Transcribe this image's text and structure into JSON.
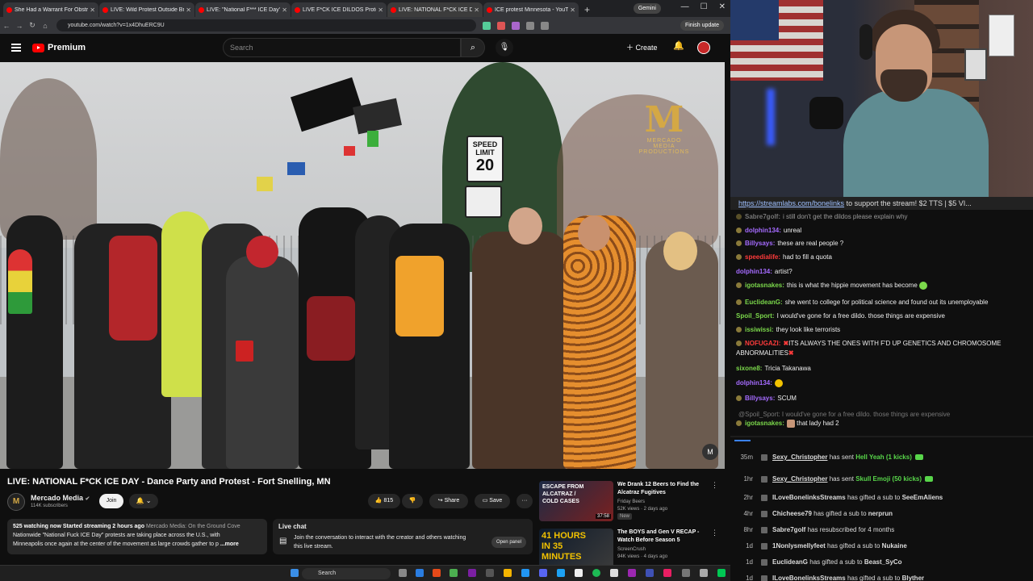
{
  "browser": {
    "tabs": [
      {
        "title": "She Had a Warrant For Obstru"
      },
      {
        "title": "LIVE: Wild Protest Outside Bro"
      },
      {
        "title": "LIVE: \"National F*** ICE Day\" Pa"
      },
      {
        "title": "LIVE F*CK ICE DILDOS Protest I"
      },
      {
        "title": "LIVE: NATIONAL F*CK ICE D"
      },
      {
        "title": "ICE protest Minnesota - YouTu"
      }
    ],
    "new_tab": "+",
    "gemini": "Gemini",
    "url": "youtube.com/watch?v=1x4DhuERC9U",
    "finish_update": "Finish update"
  },
  "youtube": {
    "logo": "Premium",
    "search_placeholder": "Search",
    "create": "Create"
  },
  "video": {
    "sign_top": "SPEED LIMIT",
    "sign_num": "20",
    "watermark_big": "M",
    "watermark_small": "MERCADO MEDIA PRODUCTIONS",
    "corner_logo": "M",
    "title": "LIVE: NATIONAL F*CK ICE DAY - Dance Party and Protest - Fort Snelling, MN"
  },
  "channel": {
    "name": "Mercado Media",
    "subs": "114K subscribers",
    "join": "Join",
    "likes": "815",
    "share": "Share",
    "save": "Save",
    "more": "···"
  },
  "description": {
    "stats": "525 watching now  Started streaming 2 hours ago",
    "snippet": "Mercado Media: On the Ground Cove",
    "line2": "Nationwide \"National Fuck ICE Day\" protests are taking place across the U.S., with",
    "line3": "Minneapolis once again at the center of the movement as large crowds gather to p",
    "more": "...more"
  },
  "livechat": {
    "title": "Live chat",
    "body": "Join the conversation to interact with the creator and others watching this live stream.",
    "open": "Open panel"
  },
  "recs": [
    {
      "title": "We Drank 12 Beers to Find the Alcatraz Fugitives",
      "channel": "Friday Beers",
      "meta": "52K views · 2 days ago",
      "badge": "New",
      "duration": "37:58",
      "thumb_text": "ESCAPE FROM ALCATRAZ / COLD CASES"
    },
    {
      "title": "The BOYS and Gen V RECAP - Watch Before Season 5",
      "channel": "ScreenCrush",
      "meta": "94K views · 4 days ago",
      "thumb_text": "41 HOURS IN 35 MINUTES"
    }
  ],
  "taskbar": {
    "search": "Search"
  },
  "stream": {
    "ticker_link": "https://streamlabs.com/bonelinks",
    "ticker_rest": " to support the stream! $2 TTS | $5 VI..."
  },
  "chat": [
    {
      "user": "Sabre7golf:",
      "text": "i still don't get the dildos please explain why",
      "color": "#bbbbbb"
    },
    {
      "user": "dolphin134:",
      "text": "unreal",
      "color": "#a56bff"
    },
    {
      "user": "Billysays:",
      "text": "these are real people ?",
      "color": "#a56bff"
    },
    {
      "user": "speedialife:",
      "text": "had to fill a quota",
      "color": "#ff3b3b"
    },
    {
      "user": "dolphin134:",
      "text": "artist?",
      "color": "#a56bff"
    },
    {
      "user": "igotasnakes:",
      "text": "this is what the hippie movement has become",
      "color": "#7bd84b"
    },
    {
      "user": "EuclideanG:",
      "text": "she went to college for political science and found out its unemployable",
      "color": "#7bd84b"
    },
    {
      "user": "Spoil_Sport:",
      "text": "I would've gone for a free dildo. those things are expensive",
      "color": "#7bd84b"
    },
    {
      "user": "issiwissi:",
      "text": "they look like terrorists",
      "color": "#7bd84b"
    },
    {
      "user": "NOFUGAZI:",
      "text": "ITS ALWAYS THE ONES WITH F'D UP GENETICS AND CHROMOSOME ABNORMALITIES",
      "color": "#ff3b3b"
    },
    {
      "user": "sixone8:",
      "text": "Tricia Takanawa",
      "color": "#7bd84b"
    },
    {
      "user": "dolphin134:",
      "text": "",
      "color": "#a56bff"
    },
    {
      "user": "Billysays:",
      "text": "SCUM",
      "color": "#a56bff"
    },
    {
      "user": "igotasnakes:",
      "text": "that lady had 2",
      "color": "#7bd84b"
    }
  ],
  "chat_reply": "@Spoil_Sport: I would've gone for a free dildo. those things are expensive",
  "events": [
    {
      "time": "35m",
      "user": "Sexy_Christopher",
      "action": "has sent",
      "item": "Hell Yeah (1 kicks)",
      "kicks": true
    },
    {
      "time": "1hr",
      "user": "Sexy_Christopher",
      "action": "has sent",
      "item": "Skull Emoji (50 kicks)",
      "kicks": true
    },
    {
      "time": "2hr",
      "user": "ILoveBonelinksStreams",
      "action": "has gifted a sub to",
      "item": "SeeEmAliens",
      "kicks": false
    },
    {
      "time": "4hr",
      "user": "Chicheese79",
      "action": "has gifted a sub to",
      "item": "nerprun",
      "kicks": false
    },
    {
      "time": "8hr",
      "user": "Sabre7golf",
      "action": "has resubscribed for 4 months",
      "item": "",
      "kicks": false
    },
    {
      "time": "1d",
      "user": "1Nonlysmellyfeet",
      "action": "has gifted a sub to",
      "item": "Nukaine",
      "kicks": false
    },
    {
      "time": "1d",
      "user": "EuclideanG",
      "action": "has gifted a sub to",
      "item": "Beast_SyCo",
      "kicks": false
    },
    {
      "time": "1d",
      "user": "ILoveBonelinksStreams",
      "action": "has gifted a sub to",
      "item": "Blyther",
      "kicks": false
    }
  ]
}
